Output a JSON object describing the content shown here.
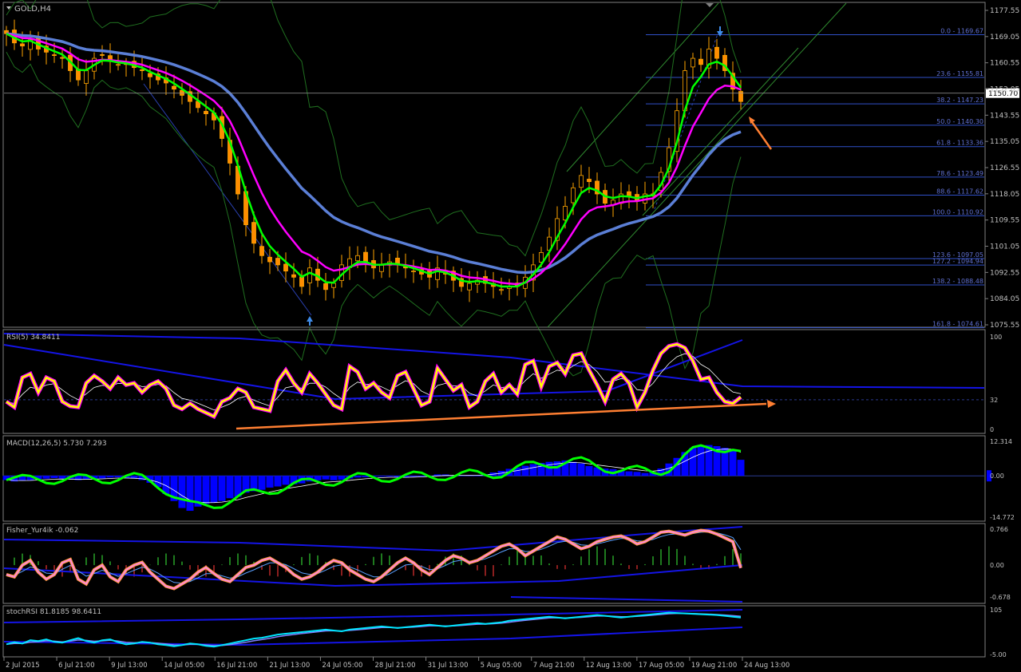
{
  "colors": {
    "background": "#000000",
    "frame": "#808080",
    "price_axis_text": "#c0c0c0",
    "candle_up": "#ffa500",
    "candle_down": "#ff8c00",
    "ema_fast": "#00ff00",
    "ema_mid": "#ff00ff",
    "ema_slow": "#5b7fd6",
    "bollinger": "#1f6e1f",
    "fib_line": "#3050c8",
    "fib_text": "#6070d0",
    "channel": "#2f8a2f",
    "arrow": "#ff7f32",
    "rsi_line": "#ffff00",
    "rsi_glow": "#ff00ff",
    "macd_hist": "#0000ff",
    "macd_line": "#00ff00",
    "fisher_line": "#ff8ad8",
    "stoch_line": "#00e5ff",
    "blue_band": "#1414e6",
    "current_price_bg": "#ffffff",
    "current_price_text": "#000000"
  },
  "chart_data": [
    {
      "type": "line",
      "title": "GOLD,H4",
      "panel": "price",
      "y_ticks": [
        "1177.55",
        "1169.05",
        "1160.55",
        "1152.05",
        "1143.55",
        "1135.05",
        "1126.55",
        "1118.05",
        "1109.55",
        "1101.05",
        "1092.55",
        "1084.05",
        "1075.55"
      ],
      "ylim": [
        1075.55,
        1177.55
      ],
      "current_price": "1150.70",
      "x_ticks": [
        "2 Jul 2015",
        "6 Jul 21:00",
        "9 Jul 13:00",
        "14 Jul 05:00",
        "16 Jul 21:00",
        "21 Jul 13:00",
        "24 Jul 05:00",
        "28 Jul 21:00",
        "31 Jul 13:00",
        "5 Aug 05:00",
        "7 Aug 21:00",
        "12 Aug 13:00",
        "17 Aug 05:00",
        "19 Aug 21:00",
        "24 Aug 13:00"
      ],
      "fib_levels": [
        {
          "label": "0.0 - 1169.67",
          "value": 1169.67
        },
        {
          "label": "23.6 - 1155.81",
          "value": 1155.81
        },
        {
          "label": "38.2 - 1147.23",
          "value": 1147.23
        },
        {
          "label": "50.0 - 1140.30",
          "value": 1140.3
        },
        {
          "label": "61.8 - 1133.36",
          "value": 1133.36
        },
        {
          "label": "78.6 - 1123.49",
          "value": 1123.49
        },
        {
          "label": "88.6 - 1117.62",
          "value": 1117.62
        },
        {
          "label": "100.0 - 1110.92",
          "value": 1110.92
        },
        {
          "label": "123.6 - 1097.05",
          "value": 1097.05
        },
        {
          "label": "127.2 - 1094.94",
          "value": 1094.94
        },
        {
          "label": "138.2 - 1088.48",
          "value": 1088.48
        },
        {
          "label": "161.8 - 1074.61",
          "value": 1074.61
        }
      ],
      "close_path": [
        1170,
        1167,
        1166,
        1168,
        1165,
        1164,
        1163,
        1162,
        1158,
        1155,
        1158,
        1162,
        1163,
        1161,
        1160,
        1160,
        1159,
        1158,
        1156,
        1155,
        1154,
        1152,
        1150,
        1148,
        1146,
        1144,
        1142,
        1136,
        1128,
        1118,
        1108,
        1102,
        1098,
        1096,
        1095,
        1093,
        1091,
        1088,
        1094,
        1090,
        1087,
        1089,
        1095,
        1097,
        1098,
        1096,
        1094,
        1095,
        1096,
        1095,
        1094,
        1093,
        1092,
        1091,
        1094,
        1092,
        1090,
        1088,
        1089,
        1090,
        1089,
        1088,
        1087,
        1088,
        1088,
        1091,
        1095,
        1099,
        1104,
        1110,
        1114,
        1120,
        1124,
        1122,
        1118,
        1115,
        1116,
        1118,
        1117,
        1116,
        1118,
        1118,
        1125,
        1133,
        1145,
        1158,
        1162,
        1160,
        1165,
        1162,
        1158,
        1152,
        1148
      ]
    },
    {
      "type": "line",
      "panel": "rsi",
      "title": "RSI(5) 34.8411",
      "y_ticks": [
        "100",
        "32",
        "0"
      ],
      "ylim": [
        0,
        100
      ],
      "values": [
        30,
        24,
        56,
        60,
        40,
        56,
        52,
        30,
        25,
        24,
        50,
        58,
        52,
        44,
        56,
        48,
        50,
        40,
        48,
        52,
        44,
        26,
        22,
        28,
        22,
        18,
        14,
        30,
        34,
        44,
        40,
        24,
        22,
        20,
        52,
        64,
        50,
        40,
        60,
        50,
        38,
        26,
        22,
        68,
        62,
        44,
        50,
        40,
        34,
        58,
        62,
        44,
        26,
        30,
        66,
        54,
        42,
        48,
        24,
        30,
        52,
        60,
        40,
        48,
        38,
        70,
        74,
        46,
        68,
        72,
        60,
        80,
        82,
        64,
        48,
        30,
        54,
        60,
        50,
        24,
        40,
        64,
        82,
        90,
        92,
        88,
        74,
        54,
        56,
        40,
        30,
        28,
        34.8
      ]
    },
    {
      "type": "bar",
      "panel": "macd",
      "title": "MACD(12,26,5) 5.730 7.293",
      "y_ticks": [
        "12.314",
        "0.00",
        "-14.772"
      ],
      "ylim": [
        -14.772,
        12.314
      ],
      "values": [
        -1.5,
        -2,
        -1.8,
        -1.6,
        -1.2,
        -1,
        -0.8,
        -1,
        -1.3,
        -1.5,
        -1.2,
        -1,
        -0.9,
        -0.6,
        -0.5,
        -0.8,
        -1,
        -1.5,
        -2.5,
        -4,
        -6.5,
        -9,
        -11.5,
        -12.5,
        -11,
        -10,
        -9.5,
        -9,
        -8,
        -7.5,
        -6,
        -5.5,
        -5,
        -4.2,
        -3.8,
        -3.2,
        -3,
        -2.7,
        -2,
        -1.6,
        -1.3,
        -1.6,
        -1.4,
        -1,
        -0.6,
        -0.5,
        -0.3,
        -0.2,
        -0.2,
        -0.5,
        -0.6,
        -0.3,
        -0.2,
        0,
        0.5,
        0.5,
        0.2,
        0.2,
        0.3,
        0.2,
        0.6,
        1.2,
        1.8,
        2.5,
        3,
        3.6,
        4.2,
        4.6,
        5,
        5.2,
        5.5,
        5,
        4.4,
        3.5,
        3,
        2.6,
        2.4,
        2,
        1.6,
        1.4,
        1,
        1.4,
        2.6,
        4.4,
        6.4,
        8.5,
        10,
        10.8,
        11,
        10.6,
        10,
        9.4,
        5.73
      ]
    },
    {
      "type": "bar",
      "panel": "fisher",
      "title": "Fisher_Yur4ik -0.062",
      "y_ticks": [
        "0.766",
        "0.00",
        "-0.678"
      ],
      "ylim": [
        -0.678,
        0.766
      ],
      "values": [
        -0.2,
        -0.25,
        0,
        0.1,
        -0.15,
        -0.3,
        -0.2,
        0.05,
        0.12,
        -0.3,
        -0.4,
        -0.1,
        0,
        -0.25,
        -0.35,
        -0.1,
        0,
        0.06,
        -0.15,
        -0.3,
        -0.45,
        -0.5,
        -0.4,
        -0.3,
        -0.15,
        -0.05,
        -0.18,
        -0.3,
        -0.35,
        -0.2,
        -0.05,
        0,
        0.1,
        0.15,
        0.05,
        -0.05,
        -0.2,
        -0.3,
        -0.25,
        -0.15,
        0,
        0.1,
        0.05,
        -0.1,
        -0.2,
        -0.3,
        -0.35,
        -0.25,
        -0.1,
        0.05,
        0.15,
        0.05,
        -0.1,
        -0.2,
        -0.05,
        0.1,
        0.2,
        0.15,
        0.05,
        0.1,
        0.2,
        0.3,
        0.4,
        0.45,
        0.35,
        0.2,
        0.3,
        0.4,
        0.5,
        0.6,
        0.55,
        0.45,
        0.35,
        0.4,
        0.5,
        0.55,
        0.6,
        0.62,
        0.55,
        0.45,
        0.5,
        0.6,
        0.7,
        0.72,
        0.68,
        0.64,
        0.7,
        0.74,
        0.72,
        0.66,
        0.58,
        0.5,
        -0.062
      ]
    },
    {
      "type": "line",
      "panel": "stochrsi",
      "title": "stochRSI 81.8185 98.6411",
      "y_ticks": [
        "105",
        "-5.00"
      ],
      "ylim": [
        -5,
        105
      ],
      "values": [
        20,
        25,
        22,
        30,
        28,
        32,
        26,
        24,
        30,
        35,
        28,
        24,
        30,
        32,
        25,
        20,
        22,
        26,
        24,
        20,
        18,
        15,
        18,
        22,
        20,
        16,
        14,
        18,
        22,
        26,
        30,
        34,
        36,
        40,
        44,
        46,
        48,
        50,
        52,
        54,
        56,
        54,
        52,
        56,
        58,
        60,
        62,
        64,
        62,
        60,
        62,
        64,
        66,
        68,
        66,
        64,
        66,
        68,
        70,
        72,
        70,
        72,
        74,
        78,
        80,
        82,
        84,
        86,
        88,
        86,
        84,
        86,
        88,
        90,
        92,
        90,
        88,
        86,
        88,
        90,
        92,
        94,
        96,
        98,
        97,
        96,
        95,
        94,
        93,
        92,
        90,
        88,
        86
      ]
    }
  ]
}
